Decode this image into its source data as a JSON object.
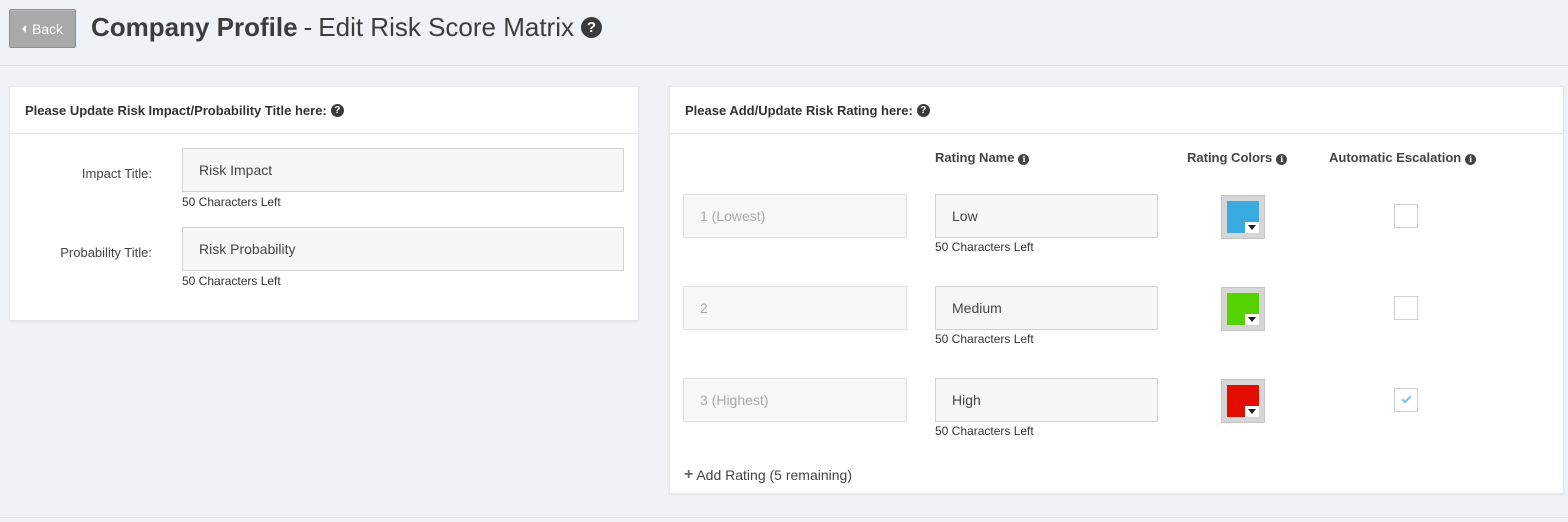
{
  "header": {
    "back_label": "Back",
    "title_bold": "Company Profile",
    "title_sep": "-",
    "title_rest": "Edit Risk Score Matrix",
    "help_glyph": "?"
  },
  "left_panel": {
    "heading": "Please Update Risk Impact/Probability Title here:",
    "impact": {
      "label": "Impact Title:",
      "value": "Risk Impact",
      "chars_left": "50 Characters Left"
    },
    "probability": {
      "label": "Probability Title:",
      "value": "Risk Probability",
      "chars_left": "50 Characters Left"
    }
  },
  "right_panel": {
    "heading": "Please Add/Update Risk Rating here:",
    "columns": {
      "rating_name": "Rating Name",
      "rating_colors": "Rating Colors",
      "automatic_escalation": "Automatic Escalation"
    },
    "rows": [
      {
        "level": "1 (Lowest)",
        "name": "Low",
        "chars_left": "50 Characters Left",
        "color": "#3aabe1",
        "escalation": false
      },
      {
        "level": "2",
        "name": "Medium",
        "chars_left": "50 Characters Left",
        "color": "#55d300",
        "escalation": false
      },
      {
        "level": "3 (Highest)",
        "name": "High",
        "chars_left": "50 Characters Left",
        "color": "#e20d00",
        "escalation": true
      }
    ],
    "add_rating": "Add Rating (5 remaining)"
  },
  "icons": {
    "back": "caret-left-icon",
    "help": "question-circle-icon",
    "info": "info-circle-icon",
    "add": "plus-icon",
    "check": "check-icon",
    "dropdown": "caret-down-icon"
  }
}
